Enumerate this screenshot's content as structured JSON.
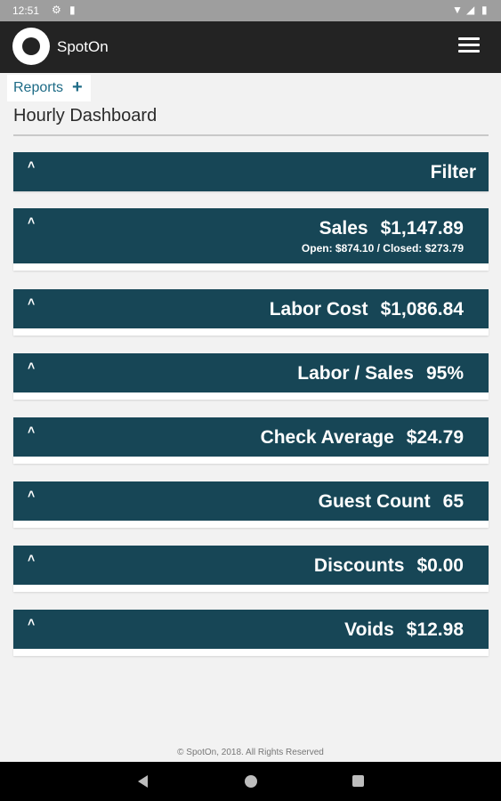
{
  "status": {
    "time": "12:51"
  },
  "app": {
    "brand": "SpotOn"
  },
  "reports": {
    "label": "Reports",
    "plus": "+"
  },
  "page": {
    "title": "Hourly Dashboard"
  },
  "filter": {
    "label": "Filter"
  },
  "cards": {
    "sales": {
      "label": "Sales",
      "value": "$1,147.89",
      "sub": "Open: $874.10 / Closed: $273.79"
    },
    "labor_cost": {
      "label": "Labor Cost",
      "value": "$1,086.84"
    },
    "labor_sales": {
      "label": "Labor / Sales",
      "value": "95%"
    },
    "check_average": {
      "label": "Check Average",
      "value": "$24.79"
    },
    "guest_count": {
      "label": "Guest Count",
      "value": "65"
    },
    "discounts": {
      "label": "Discounts",
      "value": "$0.00"
    },
    "voids": {
      "label": "Voids",
      "value": "$12.98"
    }
  },
  "footer": {
    "text": "© SpotOn, 2018. All Rights Reserved"
  },
  "colors": {
    "header_bg": "#174656",
    "appbar_bg": "#232323",
    "accent": "#1d6b86"
  },
  "icons": {
    "caret": "caret-up-icon",
    "menu": "hamburger-menu-icon",
    "plus": "plus-icon"
  }
}
